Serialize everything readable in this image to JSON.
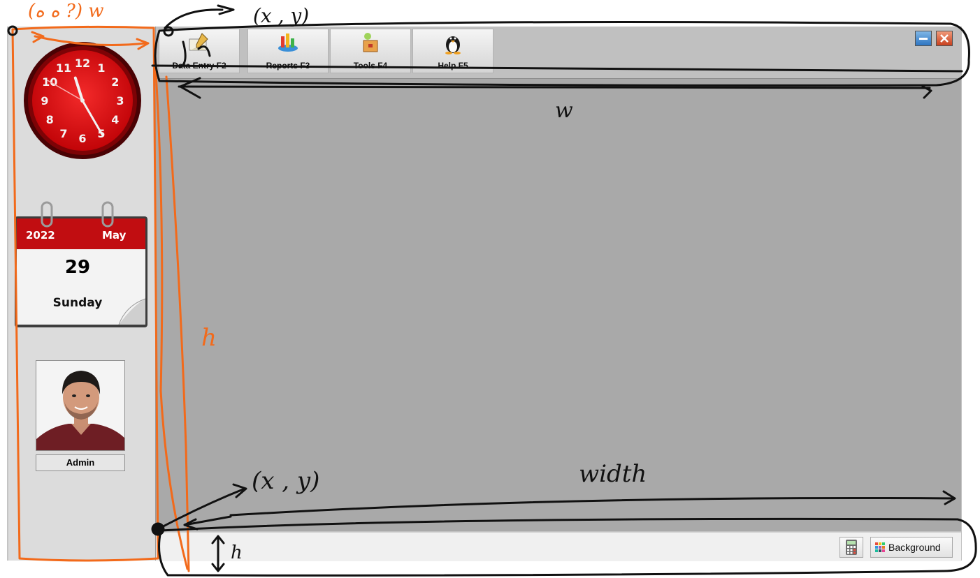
{
  "toolbar": {
    "buttons": [
      {
        "label": "Data Entry F2",
        "icon": "data-entry-icon"
      },
      {
        "label": "Reports F3",
        "icon": "reports-chart-icon"
      },
      {
        "label": "Tools F4",
        "icon": "tools-box-icon"
      },
      {
        "label": "Help F5",
        "icon": "penguin-help-icon"
      }
    ],
    "window_controls": {
      "minimize_icon": "minimize-icon",
      "close_icon": "close-icon"
    }
  },
  "sidebar": {
    "clock": {
      "numerals": [
        "12",
        "1",
        "2",
        "3",
        "4",
        "5",
        "6",
        "7",
        "8",
        "9",
        "10",
        "11"
      ],
      "hour": 11,
      "minute": 25,
      "second": 50,
      "face_color": "#d7080d"
    },
    "calendar": {
      "year": "2022",
      "month": "May",
      "day": "29",
      "weekday": "Sunday",
      "header_color": "#c10d11"
    },
    "user": {
      "name": "Admin",
      "avatar_icon": "user-photo"
    }
  },
  "statusbar": {
    "calculator_icon": "calculator-icon",
    "background_label": "Background",
    "background_icon": "color-grid-icon"
  },
  "annotations": {
    "sidebar_size_note": "(ه ه ?) w",
    "top_coords": "(x , y)",
    "top_width": "w",
    "left_height": "h",
    "bottom_coords": "(x , y)",
    "bottom_width": "width",
    "bottom_height": "h",
    "accent_orange": "#f26a1b",
    "ink_black": "#111111"
  }
}
